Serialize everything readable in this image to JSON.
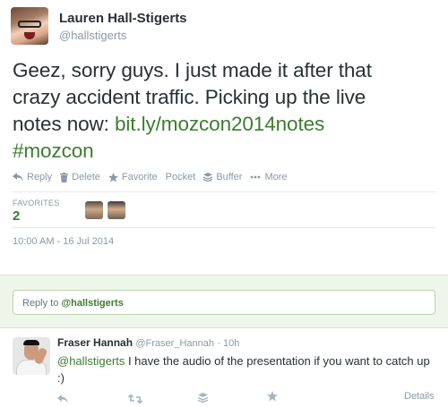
{
  "tweet": {
    "author_name": "Lauren Hall-Stigerts",
    "author_handle": "@hallstigerts",
    "text_line1": "Geez, sorry guys. I just made it after that",
    "text_line2": "crazy accident traffic. Picking up the live",
    "text_line3_prefix": "notes now: ",
    "link": "bit.ly/mozcon2014notes",
    "hashtag": "#mozcon",
    "actions": {
      "reply": "Reply",
      "delete": "Delete",
      "favorite": "Favorite",
      "pocket": "Pocket",
      "buffer": "Buffer",
      "more": "More"
    },
    "favorites_label": "FAVORITES",
    "favorites_count": "2",
    "timestamp": "10:00 AM - 16 Jul 2014"
  },
  "reply_box": {
    "prefix": "Reply to ",
    "handle": "@hallstigerts"
  },
  "reply_tweet": {
    "name": "Fraser Hannah",
    "handle": "@Fraser_Hannah",
    "time": "· 10h",
    "mention": "@hallstigerts",
    "text_rest": " I have the audio of the presentation if you want to catch up :)",
    "details_label": "Details"
  },
  "colors": {
    "accent": "#3b7d2f",
    "muted": "#8899a6",
    "text": "#292f33",
    "reply_bg": "#eef6ea"
  },
  "icons": [
    "reply-icon",
    "trash-icon",
    "star-icon",
    "buffer-icon",
    "more-dots-icon",
    "retweet-icon"
  ]
}
